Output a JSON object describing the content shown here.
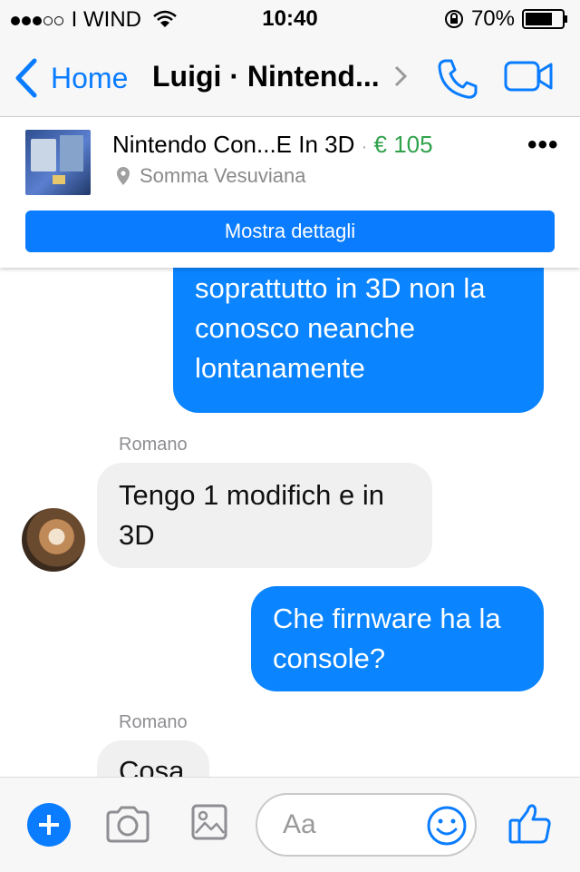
{
  "status_bar": {
    "carrier": "I WIND",
    "time": "10:40",
    "battery": "70%",
    "signal_bars_filled": 3,
    "signal_bars_total": 5
  },
  "nav": {
    "back_label": "Home",
    "title": "Luigi · Nintend...",
    "icons": [
      "back-chevron-icon",
      "chevron-right-icon",
      "phone-icon",
      "video-camera-icon"
    ]
  },
  "listing": {
    "title": "Nintendo  Con...E In 3D",
    "separator": "·",
    "price": "€ 105",
    "location": "Somma Vesuviana",
    "details_button": "Mostra dettagli",
    "more_label": "•••"
  },
  "messages": [
    {
      "from": "me",
      "lines": [
        "soprattutto in 3D non la",
        "conosco neanche",
        "lontanamente"
      ]
    },
    {
      "from": "Romano",
      "sender_label": "Romano",
      "lines": [
        "Tengo 1 modifich e in",
        "3D"
      ]
    },
    {
      "from": "me",
      "lines": [
        "Che firnware ha la",
        "console?"
      ]
    },
    {
      "from": "Romano",
      "sender_label": "Romano",
      "lines": [
        "Cosa"
      ]
    }
  ],
  "composer": {
    "placeholder": "Aa",
    "icons": [
      "plus-icon",
      "camera-icon",
      "gallery-icon",
      "emoji-icon",
      "thumbs-up-icon"
    ]
  },
  "colors": {
    "accent": "#0a7cff",
    "outgoing_bubble": "#0a84ff",
    "incoming_bubble": "#f0f0f0",
    "price": "#31a24c"
  }
}
